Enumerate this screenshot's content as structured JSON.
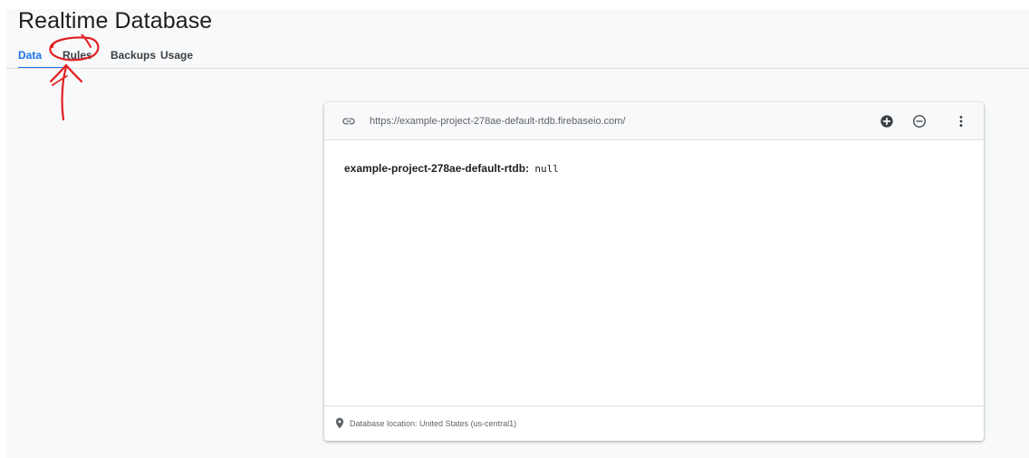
{
  "page": {
    "title": "Realtime Database"
  },
  "tabs": [
    {
      "label": "Data",
      "active": true
    },
    {
      "label": "Rules",
      "active": false
    },
    {
      "label": "Backups",
      "active": false
    },
    {
      "label": "Usage",
      "active": false
    }
  ],
  "database": {
    "url": "https://example-project-278ae-default-rtdb.firebaseio.com/",
    "root_key": "example-project-278ae-default-rtdb",
    "separator": ":",
    "root_value": "null",
    "location": "Database location: United States (us-central1)"
  },
  "icons": {
    "link": "link-icon",
    "add": "add-circle-icon",
    "remove": "remove-circle-icon",
    "more": "more-vert-icon",
    "location": "location-pin-icon"
  },
  "colors": {
    "accent": "#1a73e8",
    "annotation": "#e02020",
    "text_primary": "#202124",
    "text_secondary": "#5f6368",
    "background": "#f8f9fa"
  }
}
